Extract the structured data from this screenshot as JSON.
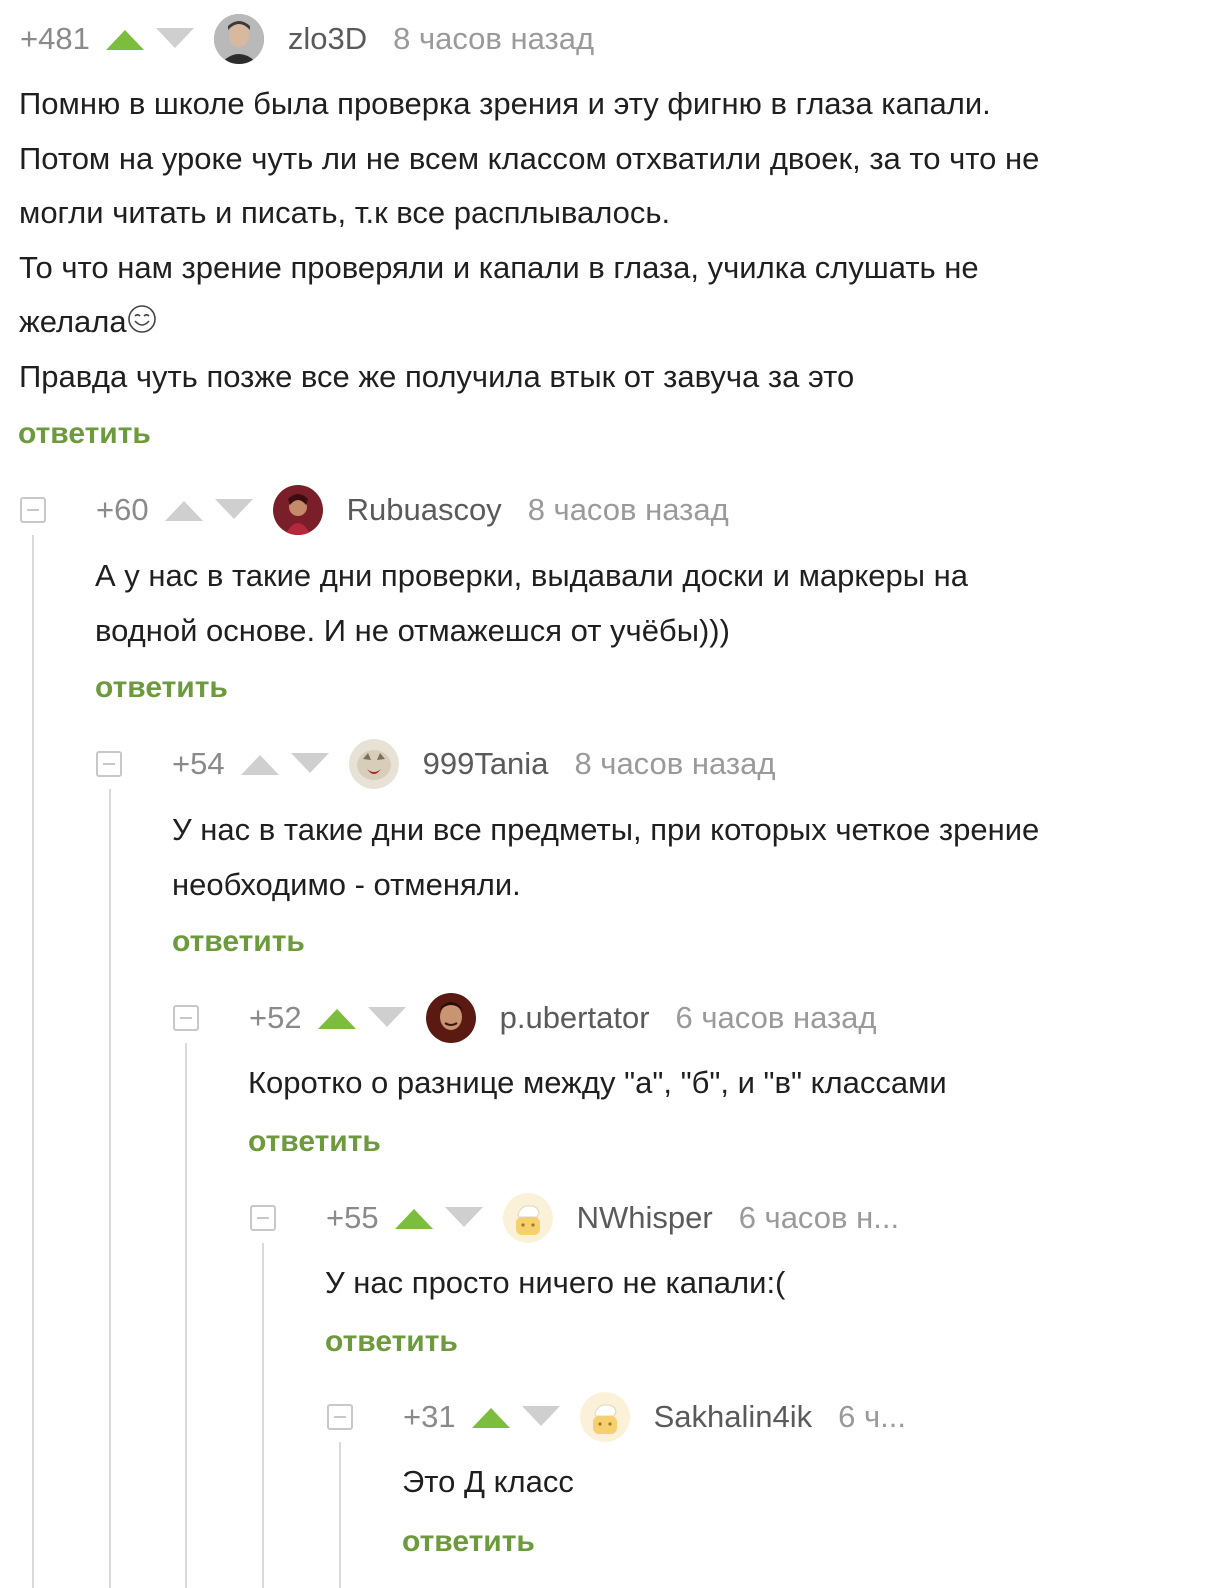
{
  "colors": {
    "accent_green": "#6c9a3c",
    "vote_active": "#7cbd3d",
    "vote_inactive": "#cfcfcf",
    "muted_text": "#9a9a9a",
    "branch_line": "#dadada"
  },
  "reply_label": "ответить",
  "comments": [
    {
      "rating": "+481",
      "username": "zlo3D",
      "time": "8 часов назад",
      "avatar_icon": "user-avatar-photo",
      "upvote_active": true,
      "body": [
        "Помню в школе была проверка зрения и эту фигню в глаза капали.",
        "Потом на уроке чуть ли не всем классом отхватили двоек, за то что не",
        "могли читать и писать, т.к все расплывалось.",
        "То что нам зрение проверяли и капали в глаза, училка слушать не",
        "желала",
        "Правда чуть позже все же получила втык от завуча за это"
      ],
      "emoji_icon": "smiling-face-icon"
    },
    {
      "rating": "+60",
      "username": "Rubuascoy",
      "time": "8 часов назад",
      "avatar_icon": "user-avatar-photo",
      "upvote_active": false,
      "body": [
        "А у нас в такие дни проверки, выдавали доски и маркеры на",
        "водной основе. И не отмажешся от учёбы)))"
      ]
    },
    {
      "rating": "+54",
      "username": "999Tania",
      "time": "8 часов назад",
      "avatar_icon": "user-avatar-photo",
      "upvote_active": false,
      "body": [
        "У нас в такие дни все предметы, при которых четкое зрение",
        "необходимо - отменяли."
      ]
    },
    {
      "rating": "+52",
      "username": "p.ubertator",
      "time": "6 часов назад",
      "avatar_icon": "user-avatar-photo",
      "upvote_active": true,
      "body": [
        "Коротко о разнице между \"а\", \"б\", и \"в\" классами"
      ]
    },
    {
      "rating": "+55",
      "username": "NWhisper",
      "time": "6 часов н...",
      "avatar_icon": "default-avatar-icon",
      "upvote_active": true,
      "body": [
        "У нас просто ничего не капали:("
      ]
    },
    {
      "rating": "+31",
      "username": "Sakhalin4ik",
      "time": "6 ч...",
      "avatar_icon": "default-avatar-icon",
      "upvote_active": true,
      "body": [
        "Это Д класс"
      ]
    }
  ]
}
